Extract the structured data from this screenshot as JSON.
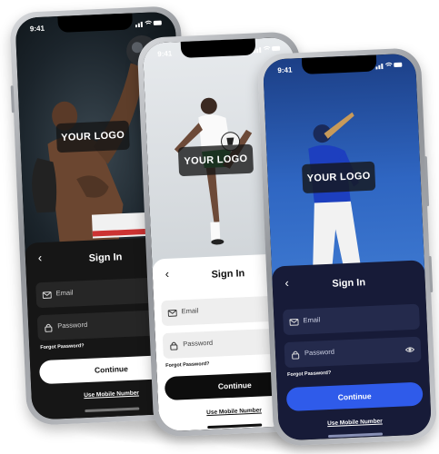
{
  "status_time": "9:41",
  "logo_text": "YOUR LOGO",
  "title": "Sign In",
  "email_placeholder": "Email",
  "password_placeholder": "Password",
  "forgot_label": "Forgot Password?",
  "continue_label": "Continue",
  "mobile_label": "Use Mobile Number",
  "colors": {
    "dark_sheet": "#161616",
    "light_sheet": "#ffffff",
    "navy_sheet": "#171b38",
    "accent_blue": "#2f5bea",
    "sky_bg": "#2a5cb5",
    "boxing_bg": "#1d2a33",
    "soccer_bg": "#d9dde1"
  },
  "icons": [
    "back-chevron-icon",
    "mail-icon",
    "lock-icon",
    "eye-icon",
    "signal-icon",
    "wifi-icon",
    "battery-icon"
  ]
}
